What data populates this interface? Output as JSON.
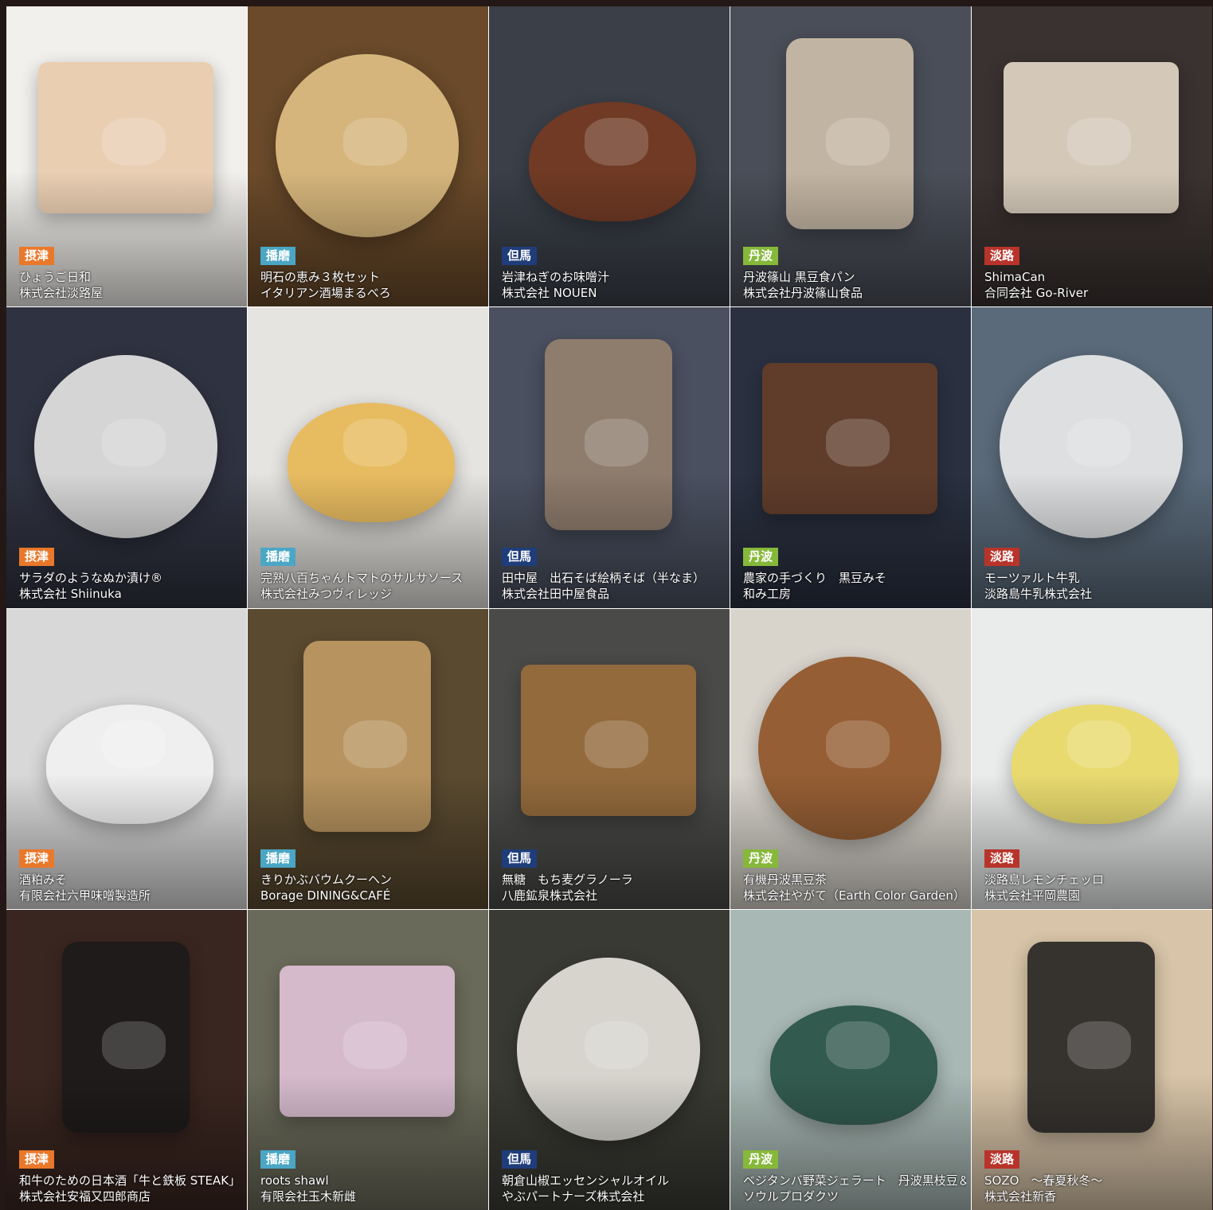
{
  "region_colors": {
    "摂津": "#e9782b",
    "播磨": "#4aa6c4",
    "但馬": "#1f3d7a",
    "丹波": "#86b83a",
    "淡路": "#b8342b"
  },
  "items": [
    {
      "region": "摂津",
      "product": "ひょうご日和",
      "company": "株式会社淡路屋",
      "photo_bg": "#f2f0ec",
      "photo_accent": "#e8c9a8",
      "photo_dark": false
    },
    {
      "region": "播磨",
      "product": "明石の恵み３枚セット",
      "company": "イタリアン酒場まるべろ",
      "photo_bg": "#6a4a2a",
      "photo_accent": "#e8c88a",
      "photo_dark": true
    },
    {
      "region": "但馬",
      "product": "岩津ねぎのお味噌汁",
      "company": "株式会社 NOUEN",
      "photo_bg": "#3a3f48",
      "photo_accent": "#7a3a1e",
      "photo_dark": true
    },
    {
      "region": "丹波",
      "product": "丹波篠山 黒豆食パン",
      "company": "株式会社丹波篠山食品",
      "photo_bg": "#4a4e58",
      "photo_accent": "#d8c6b0",
      "photo_dark": true
    },
    {
      "region": "淡路",
      "product": "ShimaCan",
      "company": "合同会社 Go-River",
      "photo_bg": "#3a3230",
      "photo_accent": "#efe4d2",
      "photo_dark": true
    },
    {
      "region": "摂津",
      "product": "サラダのようなぬか漬け®",
      "company": "株式会社 Shiinuka",
      "photo_bg": "#2f3240",
      "photo_accent": "#f2f2f0",
      "photo_dark": true
    },
    {
      "region": "播磨",
      "product": "完熟八百ちゃんトマトのサルサソース",
      "company": "株式会社みつヴィレッジ",
      "photo_bg": "#e6e4e0",
      "photo_accent": "#e8b44a",
      "photo_dark": false
    },
    {
      "region": "但馬",
      "product": "田中屋　出石そば絵柄そば（半なま）",
      "company": "株式会社田中屋食品",
      "photo_bg": "#4a5060",
      "photo_accent": "#9a8470",
      "photo_dark": true
    },
    {
      "region": "丹波",
      "product": "農家の手づくり　黒豆みそ",
      "company": "和み工房",
      "photo_bg": "#2a3040",
      "photo_accent": "#6a4028",
      "photo_dark": true
    },
    {
      "region": "淡路",
      "product": "モーツァルト牛乳",
      "company": "淡路島牛乳株式会社",
      "photo_bg": "#5a6a7a",
      "photo_accent": "#f4f4f2",
      "photo_dark": true
    },
    {
      "region": "摂津",
      "product": "酒粕みそ",
      "company": "有限会社六甲味噌製造所",
      "photo_bg": "#d8d8d8",
      "photo_accent": "#f4f4f4",
      "photo_dark": false
    },
    {
      "region": "播磨",
      "product": "きりかぶバウムクーヘン",
      "company": "Borage DINING&CAFÉ",
      "photo_bg": "#5a4a30",
      "photo_accent": "#c8a068",
      "photo_dark": true
    },
    {
      "region": "但馬",
      "product": "無糖　もち麦グラノーラ",
      "company": "八鹿鉱泉株式会社",
      "photo_bg": "#4a4a48",
      "photo_accent": "#a0703a",
      "photo_dark": true
    },
    {
      "region": "丹波",
      "product": "有機丹波黒豆茶",
      "company": "株式会社やがて（Earth Color Garden）",
      "photo_bg": "#d8d4cc",
      "photo_accent": "#8a4a1a",
      "photo_dark": false
    },
    {
      "region": "淡路",
      "product": "淡路島レモンチェッロ",
      "company": "株式会社平岡農園",
      "photo_bg": "#eaeceb",
      "photo_accent": "#e8d85a",
      "photo_dark": false
    },
    {
      "region": "摂津",
      "product": "和牛のための日本酒「牛と鉄板 STEAK」",
      "company": "株式会社安福又四郎商店",
      "photo_bg": "#3a2620",
      "photo_accent": "#1a1a1a",
      "photo_dark": true
    },
    {
      "region": "播磨",
      "product": "roots shawl",
      "company": "有限会社玉木新雌",
      "photo_bg": "#6a6a5a",
      "photo_accent": "#e8c8e0",
      "photo_dark": true
    },
    {
      "region": "但馬",
      "product": "朝倉山椒エッセンシャルオイル",
      "company": "やぶパートナーズ株式会社",
      "photo_bg": "#3a3a34",
      "photo_accent": "#f2f0e8",
      "photo_dark": true
    },
    {
      "region": "丹波",
      "product": "ベジタンバ野菜ジェラート　丹波黒枝豆＆ミルク",
      "company": "ソウルプロダクツ",
      "photo_bg": "#a8b8b4",
      "photo_accent": "#1e4a3e",
      "photo_dark": false
    },
    {
      "region": "淡路",
      "product": "SOZO　～春夏秋冬～",
      "company": "株式会社新香",
      "photo_bg": "#d8c4a8",
      "photo_accent": "#1a1a1a",
      "photo_dark": false
    }
  ]
}
